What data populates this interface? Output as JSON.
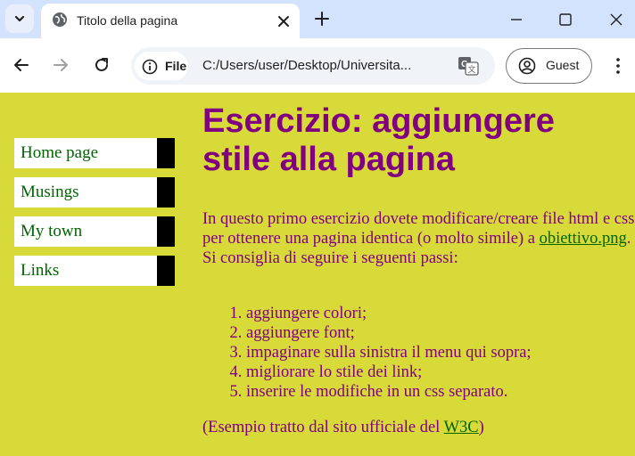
{
  "browser": {
    "tab_title": "Titolo della pagina",
    "omnibox": {
      "chip_label": "File",
      "url": "C:/Users/user/Desktop/Universita..."
    },
    "profile_label": "Guest"
  },
  "page": {
    "menu": [
      {
        "label": "Home page"
      },
      {
        "label": "Musings"
      },
      {
        "label": "My town"
      },
      {
        "label": "Links"
      }
    ],
    "heading": "Esercizio: aggiungere stile alla pagina",
    "intro": {
      "before": "In questo primo esercizio dovete modificare/creare file html e css per ottenere una pagina identica (o molto simile) a ",
      "link": "obiettivo.png",
      "after": ". Si consiglia di seguire i seguenti passi:"
    },
    "steps": [
      "aggiungere colori;",
      "aggiungere font;",
      "impaginare sulla sinistra il menu qui sopra;",
      "migliorare lo stile dei link;",
      "inserire le modifiche in un css separato."
    ],
    "footer": {
      "before": "(Esempio tratto dal sito ufficiale del ",
      "link": "W3C",
      "after": ")"
    }
  },
  "colors": {
    "page_background": "#d8da3a",
    "text_purple": "#800080",
    "link_green": "#006400",
    "tabstrip": "#d3e3fd"
  },
  "icons": [
    "chevron-down-icon",
    "globe-icon",
    "close-icon",
    "plus-icon",
    "minimize-icon",
    "maximize-icon",
    "close-window-icon",
    "back-arrow-icon",
    "forward-arrow-icon",
    "reload-icon",
    "info-icon",
    "translate-icon",
    "person-icon",
    "more-vert-icon"
  ]
}
